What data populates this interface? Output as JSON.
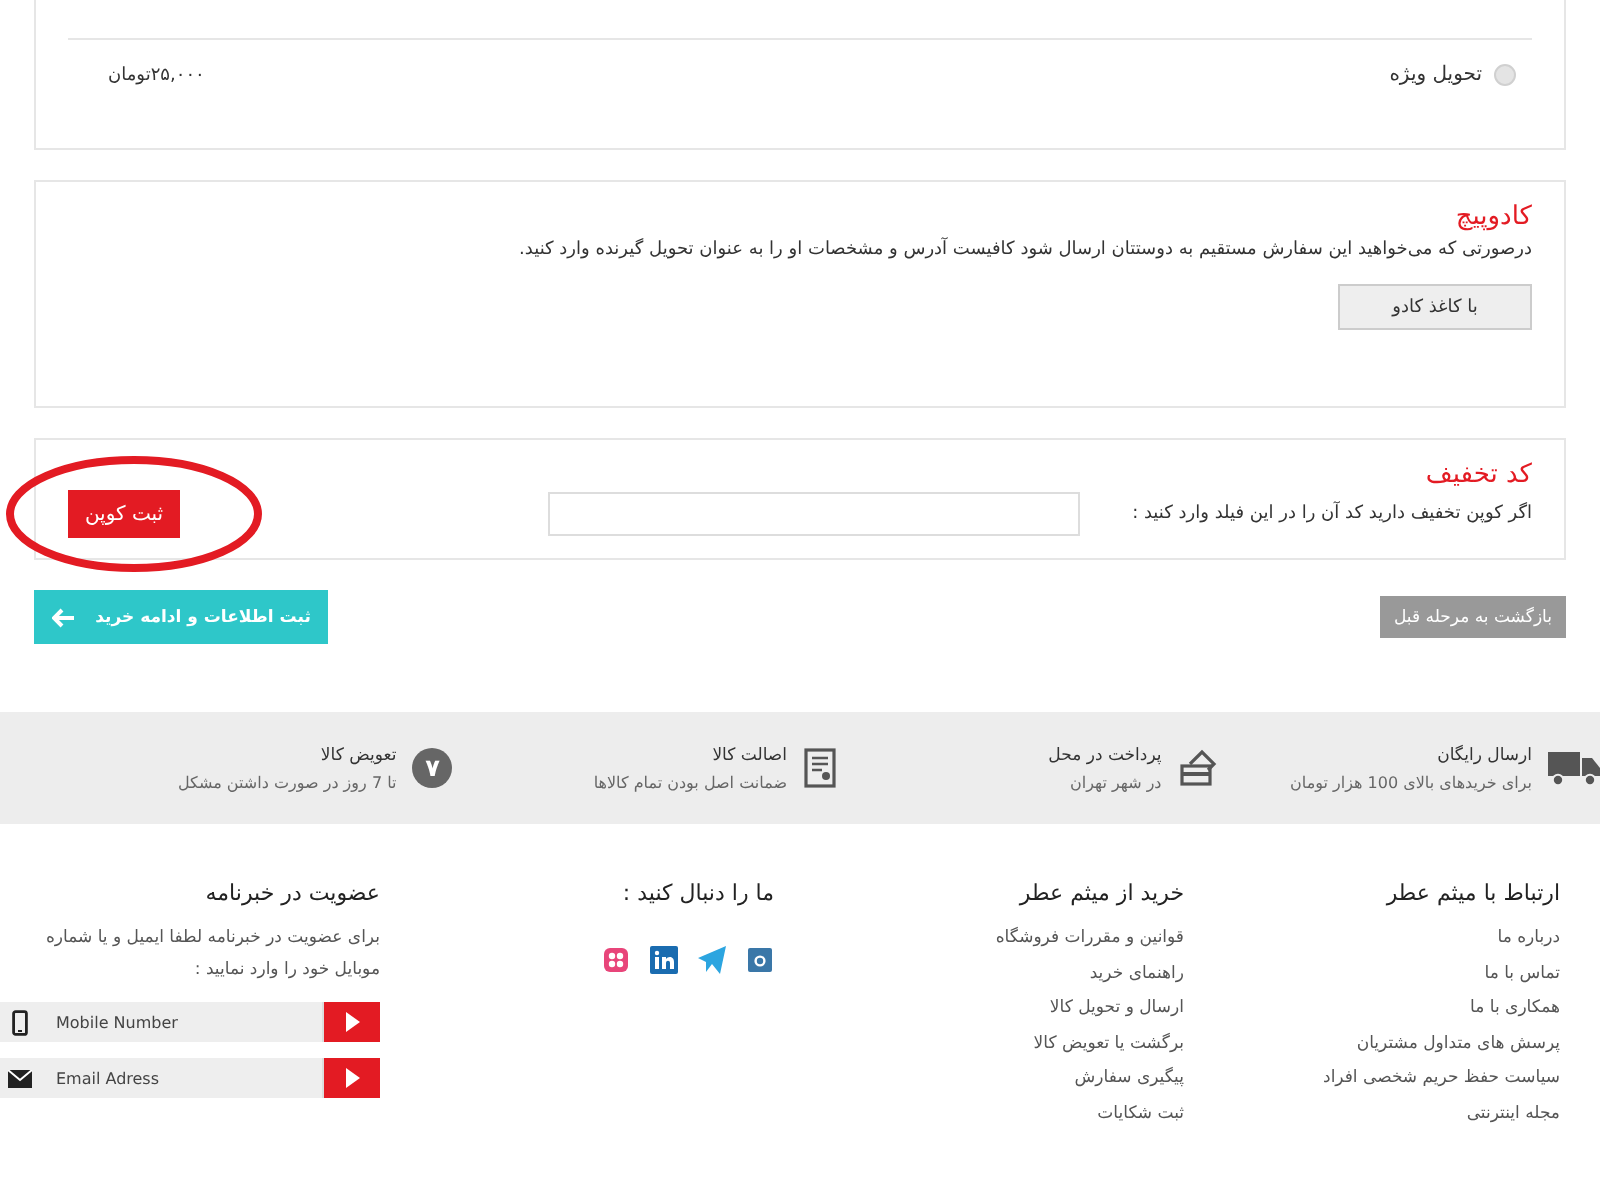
{
  "shipping": {
    "options": [
      {
        "label": "تحویل ویژه",
        "price": "۲۵,۰۰۰تومان",
        "selected": false
      }
    ]
  },
  "gift_wrap": {
    "title": "کادوپیچ",
    "description": "درصورتی که می‌خواهید این سفارش مستقیم به دوستتان ارسال شود کافیست آدرس و مشخصات او را به عنوان تحویل گیرنده وارد کنید.",
    "button": "با کاغذ کادو"
  },
  "discount": {
    "title": "کد تخفیف",
    "description": "اگر کوپن تخفیف دارید کد آن را در این فیلد وارد کنید :",
    "button": "ثبت کوپن",
    "highlighted": true
  },
  "actions": {
    "back": "بازگشت به مرحله قبل",
    "continue": "ثبت اطلاعات و ادامه خرید"
  },
  "features": [
    {
      "kind": "truck",
      "title": "ارسال رایگان",
      "subtitle": "برای خریدهای بالای 100 هزار تومان"
    },
    {
      "kind": "card",
      "title": "پرداخت در محل",
      "subtitle": "در شهر تهران"
    },
    {
      "kind": "certificate",
      "title": "اصالت کالا",
      "subtitle": "ضمانت اصل بودن تمام کالاها"
    },
    {
      "kind": "badge",
      "badge": "۷",
      "title": "تعویض کالا",
      "subtitle": "تا 7 روز در صورت داشتن مشکل"
    }
  ],
  "footer": {
    "columns": [
      {
        "title": "ارتباط با میثم عطر",
        "links": [
          "درباره ما",
          "تماس با ما",
          "همکاری با ما",
          "پرسش های متداول مشتریان",
          "سیاست حفظ حریم شخصی افراد",
          "مجله اینترنتی"
        ]
      },
      {
        "title": "خرید از میثم عطر",
        "links": [
          "قوانین و مقررات فروشگاه",
          "راهنمای خرید",
          "ارسال و تحویل کالا",
          "برگشت یا تعویض کالا",
          "پیگیری سفارش",
          "ثبت شکایات"
        ]
      }
    ],
    "social": {
      "title": "ما را دنبال کنید :",
      "icons": [
        {
          "kind": "instagram"
        },
        {
          "kind": "telegram"
        },
        {
          "kind": "linkedin"
        },
        {
          "kind": "flower"
        }
      ]
    },
    "newsletter": {
      "title": "عضویت در خبرنامه",
      "description": "برای عضویت در خبرنامه لطفا ایمیل و یا شماره موبایل خود را وارد نمایید :",
      "fields": [
        {
          "kind": "mobile",
          "placeholder": "Mobile Number"
        },
        {
          "kind": "email",
          "placeholder": "Email Adress"
        }
      ]
    }
  }
}
